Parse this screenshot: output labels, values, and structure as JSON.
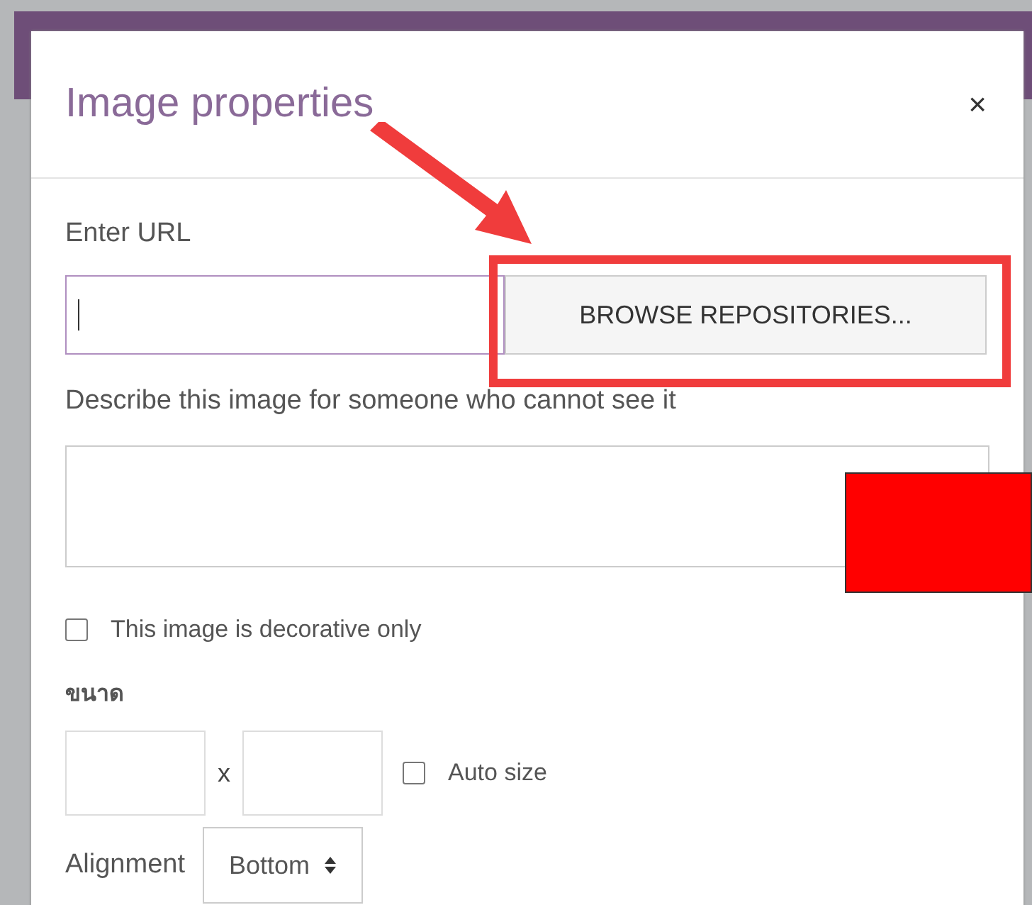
{
  "dialog": {
    "title": "Image properties",
    "close": "×"
  },
  "url": {
    "label": "Enter URL",
    "focused": true,
    "browse_button": "BROWSE REPOSITORIES..."
  },
  "alt_text": {
    "label": "Describe this image for someone who cannot see it"
  },
  "decorative": {
    "label": "This image is decorative only",
    "checked": false
  },
  "size": {
    "label": "ขนาด",
    "separator": "x",
    "auto_size": {
      "label": "Auto size",
      "checked": false
    }
  },
  "alignment": {
    "label": "Alignment",
    "value": "Bottom"
  }
}
